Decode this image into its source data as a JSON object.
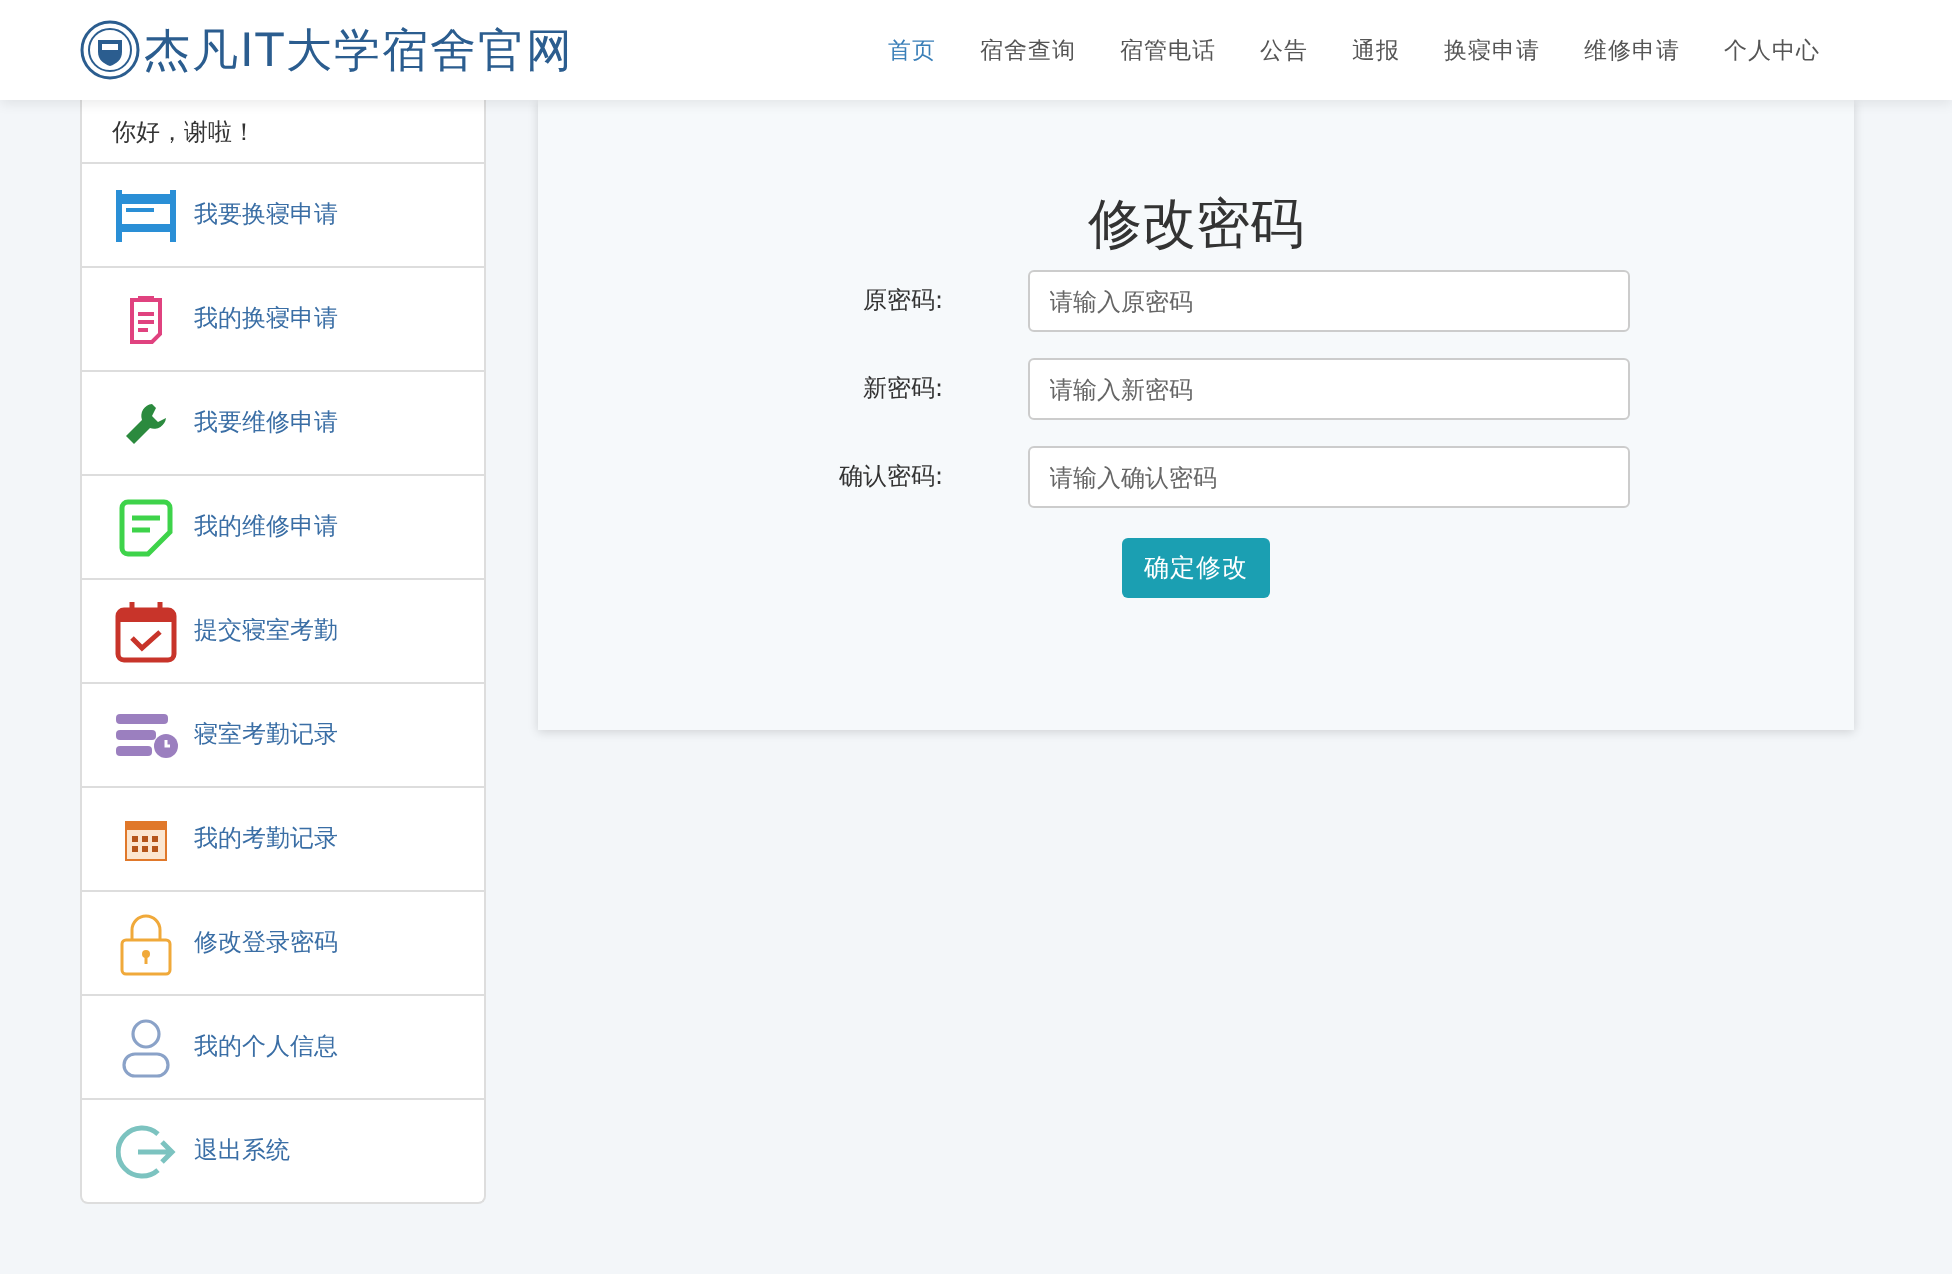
{
  "site": {
    "title": "杰凡IT大学宿舍官网"
  },
  "nav": [
    {
      "label": "首页",
      "selected": true
    },
    {
      "label": "宿舍查询",
      "selected": false
    },
    {
      "label": "宿管电话",
      "selected": false
    },
    {
      "label": "公告",
      "selected": false
    },
    {
      "label": "通报",
      "selected": false
    },
    {
      "label": "换寝申请",
      "selected": false
    },
    {
      "label": "维修申请",
      "selected": false
    },
    {
      "label": "个人中心",
      "selected": false
    }
  ],
  "sidebar": {
    "greeting": "你好，谢啦！",
    "items": [
      {
        "label": "我要换寝申请"
      },
      {
        "label": "我的换寝申请"
      },
      {
        "label": "我要维修申请"
      },
      {
        "label": "我的维修申请"
      },
      {
        "label": "提交寝室考勤"
      },
      {
        "label": "寝室考勤记录"
      },
      {
        "label": "我的考勤记录"
      },
      {
        "label": "修改登录密码"
      },
      {
        "label": "我的个人信息"
      },
      {
        "label": "退出系统"
      }
    ]
  },
  "form": {
    "title": "修改密码",
    "fields": [
      {
        "label": "原密码:",
        "placeholder": "请输入原密码"
      },
      {
        "label": "新密码:",
        "placeholder": "请输入新密码"
      },
      {
        "label": "确认密码:",
        "placeholder": "请输入确认密码"
      }
    ],
    "submit": "确定修改"
  }
}
